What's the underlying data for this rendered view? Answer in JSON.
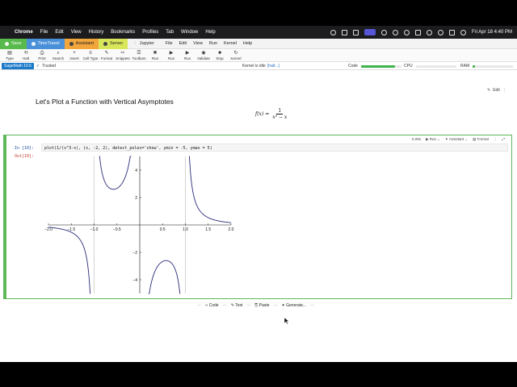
{
  "menubar": {
    "app": "Chrome",
    "items": [
      "File",
      "Edit",
      "View",
      "History",
      "Bookmarks",
      "Profiles",
      "Tab",
      "Window",
      "Help"
    ],
    "datetime": "Fri Apr 18  4:40 PM"
  },
  "toolbar": {
    "save": "Save",
    "timetravel": "TimeTravel",
    "assistant": "Assistant",
    "server": "Server",
    "jupyter": "Jupyter",
    "menus": [
      "File",
      "Edit",
      "View",
      "Run",
      "Kernel",
      "Help"
    ]
  },
  "iconbar": {
    "items": [
      {
        "label": "Type",
        "glyph": "▤",
        "icon": "type-icon"
      },
      {
        "label": "Halt",
        "glyph": "⟲",
        "icon": "halt-icon"
      },
      {
        "label": "Print",
        "glyph": "⎙",
        "icon": "print-icon"
      },
      {
        "label": "Search",
        "glyph": "⌕",
        "icon": "search-icon"
      },
      {
        "label": "Insert",
        "glyph": "+",
        "icon": "insert-icon"
      },
      {
        "label": "Cell Type",
        "glyph": "≡",
        "icon": "cell-type-icon"
      },
      {
        "label": "Format",
        "glyph": "✎",
        "icon": "format-icon"
      },
      {
        "label": "Snippets",
        "glyph": "✂",
        "icon": "snippets-icon"
      },
      {
        "label": "Toolbars",
        "glyph": "☰",
        "icon": "toolbars-icon"
      },
      {
        "label": "Run",
        "glyph": "✖",
        "icon": "run-icon"
      },
      {
        "label": "Run",
        "glyph": "▶",
        "icon": "run-all-icon"
      },
      {
        "label": "Run",
        "glyph": "▶",
        "icon": "run-selected-icon"
      },
      {
        "label": "Validate",
        "glyph": "◉",
        "icon": "validate-icon"
      },
      {
        "label": "Stop",
        "glyph": "■",
        "icon": "stop-icon"
      },
      {
        "label": "Kernel",
        "glyph": "↻",
        "icon": "kernel-icon"
      }
    ]
  },
  "status": {
    "kernel_name": "SageMath 10.6",
    "trusted": "Trusted",
    "kernel_state": "Kernel is idle",
    "halt_link": "(halt...)",
    "code_label": "Code",
    "code_level": 0.85,
    "cpu_label": "CPU",
    "cpu_level": 0.0,
    "ram_label": "RAM",
    "ram_level": 0.05
  },
  "edit_button": "Edit",
  "markdown": {
    "title": "Let's Plot a Function with Vertical Asymptotes",
    "formula_lhs": "f(x) =",
    "formula_num": "1",
    "formula_den": "x³ − x"
  },
  "cell": {
    "timing": "0.29s",
    "run_label": "Run",
    "assistant_label": "Assistant",
    "format_label": "Format",
    "in_prompt": "In [10]:",
    "code": "plot(1/(x^3-x), (x, -2, 2), detect_poles='show', ymin = -5, ymax = 5)",
    "out_prompt": "Out[10]:"
  },
  "chart_data": {
    "type": "line",
    "function": "1/(x^3-x)",
    "xlim": [
      -2,
      2
    ],
    "ylim": [
      -5,
      5
    ],
    "x_ticks": [
      -2.0,
      -1.5,
      -1.0,
      -0.5,
      0.5,
      1.0,
      1.5,
      2.0
    ],
    "x_tick_labels": [
      "−2.0",
      "−1.5",
      "−1.0",
      "−0.5",
      "0.5",
      "1.0",
      "1.5",
      "2.0"
    ],
    "y_ticks": [
      -4,
      -2,
      2,
      4
    ],
    "y_tick_labels": [
      "−4",
      "−2",
      "2",
      "4"
    ],
    "poles": [
      -1,
      0,
      1
    ],
    "series_color": "#2b2b7a",
    "pole_line_color": "#aaaaaa",
    "title": "",
    "xlabel": "",
    "ylabel": ""
  },
  "addbar": {
    "code": "Code",
    "text": "Text",
    "paste": "Paste",
    "generate": "Generate..."
  }
}
